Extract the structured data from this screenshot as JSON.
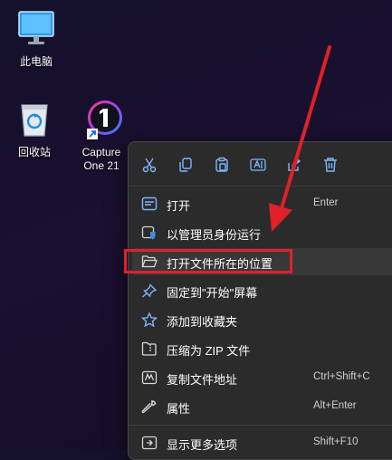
{
  "desktop": {
    "icons": [
      {
        "label": "此电脑",
        "icon": "monitor-icon"
      },
      {
        "label": "回收站",
        "icon": "recycle-bin-icon"
      },
      {
        "label": "Capture One 21",
        "icon": "capture-one-app-icon"
      }
    ]
  },
  "context_menu": {
    "toolbar": [
      {
        "name": "cut-icon"
      },
      {
        "name": "copy-icon"
      },
      {
        "name": "paste-icon"
      },
      {
        "name": "rename-icon"
      },
      {
        "name": "share-icon"
      },
      {
        "name": "delete-icon"
      }
    ],
    "items": [
      {
        "label": "打开",
        "shortcut": "Enter",
        "icon": "open-icon"
      },
      {
        "label": "以管理员身份运行",
        "shortcut": "",
        "icon": "admin-shield-icon"
      },
      {
        "label": "打开文件所在的位置",
        "shortcut": "",
        "icon": "folder-open-icon",
        "highlighted": true
      },
      {
        "label": "固定到\"开始\"屏幕",
        "shortcut": "",
        "icon": "pin-icon"
      },
      {
        "label": "添加到收藏夹",
        "shortcut": "",
        "icon": "star-icon"
      },
      {
        "label": "压缩为 ZIP 文件",
        "shortcut": "",
        "icon": "zip-folder-icon"
      },
      {
        "label": "复制文件地址",
        "shortcut": "Ctrl+Shift+C",
        "icon": "copy-path-icon"
      },
      {
        "label": "属性",
        "shortcut": "Alt+Enter",
        "icon": "wrench-icon"
      },
      {
        "label": "显示更多选项",
        "shortcut": "Shift+F10",
        "icon": "more-options-icon"
      }
    ]
  },
  "colors": {
    "accent_arrow": "#e0202a",
    "menu_bg": "#2b2b2b",
    "icon_blue": "#7fb6ff"
  }
}
